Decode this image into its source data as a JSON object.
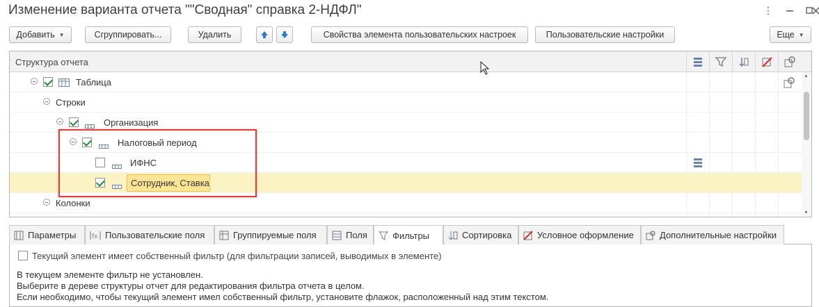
{
  "window": {
    "title": "Изменение варианта отчета \"\"Сводная\" справка 2-НДФЛ\"",
    "more_icon": "more-vertical-icon",
    "minimize_icon": "minimize-icon",
    "maximize_icon": "maximize-icon",
    "close_icon": "close-icon"
  },
  "toolbar": {
    "add": "Добавить",
    "group": "Сгруппировать...",
    "delete": "Удалить",
    "up_icon": "arrow-up-icon",
    "down_icon": "arrow-down-icon",
    "element_props": "Свойства элемента пользовательских настроек",
    "user_settings": "Пользовательские настройки",
    "more": "Еще"
  },
  "tree": {
    "header": "Структура отчета",
    "column_icons": [
      "fields-icon",
      "filter-icon",
      "sort-icon",
      "conditional-format-icon",
      "extra-settings-icon"
    ],
    "rows": [
      {
        "label": "Таблица",
        "checked": true,
        "icon": "table-icon"
      },
      {
        "label": "Строки"
      },
      {
        "label": "Организация",
        "checked": true,
        "icon": "grouping-icon"
      },
      {
        "label": "Налоговый период",
        "checked": true,
        "icon": "grouping-icon"
      },
      {
        "label": "ИФНС",
        "checked": false,
        "icon": "grouping-icon"
      },
      {
        "label": "Сотрудник, Ставка",
        "checked": true,
        "icon": "grouping-icon",
        "selected": true
      },
      {
        "label": "Колонки"
      }
    ]
  },
  "tabs": [
    {
      "label": "Параметры",
      "icon": "params-icon"
    },
    {
      "label": "Пользовательские поля",
      "icon": "user-fields-icon"
    },
    {
      "label": "Группируемые поля",
      "icon": "group-fields-icon"
    },
    {
      "label": "Поля",
      "icon": "fields-icon"
    },
    {
      "label": "Фильтры",
      "icon": "filter-icon",
      "active": true
    },
    {
      "label": "Сортировка",
      "icon": "sort-icon"
    },
    {
      "label": "Условное оформление",
      "icon": "conditional-format-icon"
    },
    {
      "label": "Дополнительные настройки",
      "icon": "extra-settings-icon"
    }
  ],
  "filter": {
    "own_filter_label": "Текущий элемент имеет собственный фильтр (для фильтрации записей, выводимых в элементе)",
    "own_filter_checked": false,
    "info_lines": [
      "В текущем элементе фильтр не установлен.",
      "Выберите в дереве структуры отчет для редактирования фильтра отчета в целом.",
      "Если необходимо, чтобы текущий элемент имел собственный фильтр, установите флажок, расположенный над этим текстом."
    ]
  }
}
